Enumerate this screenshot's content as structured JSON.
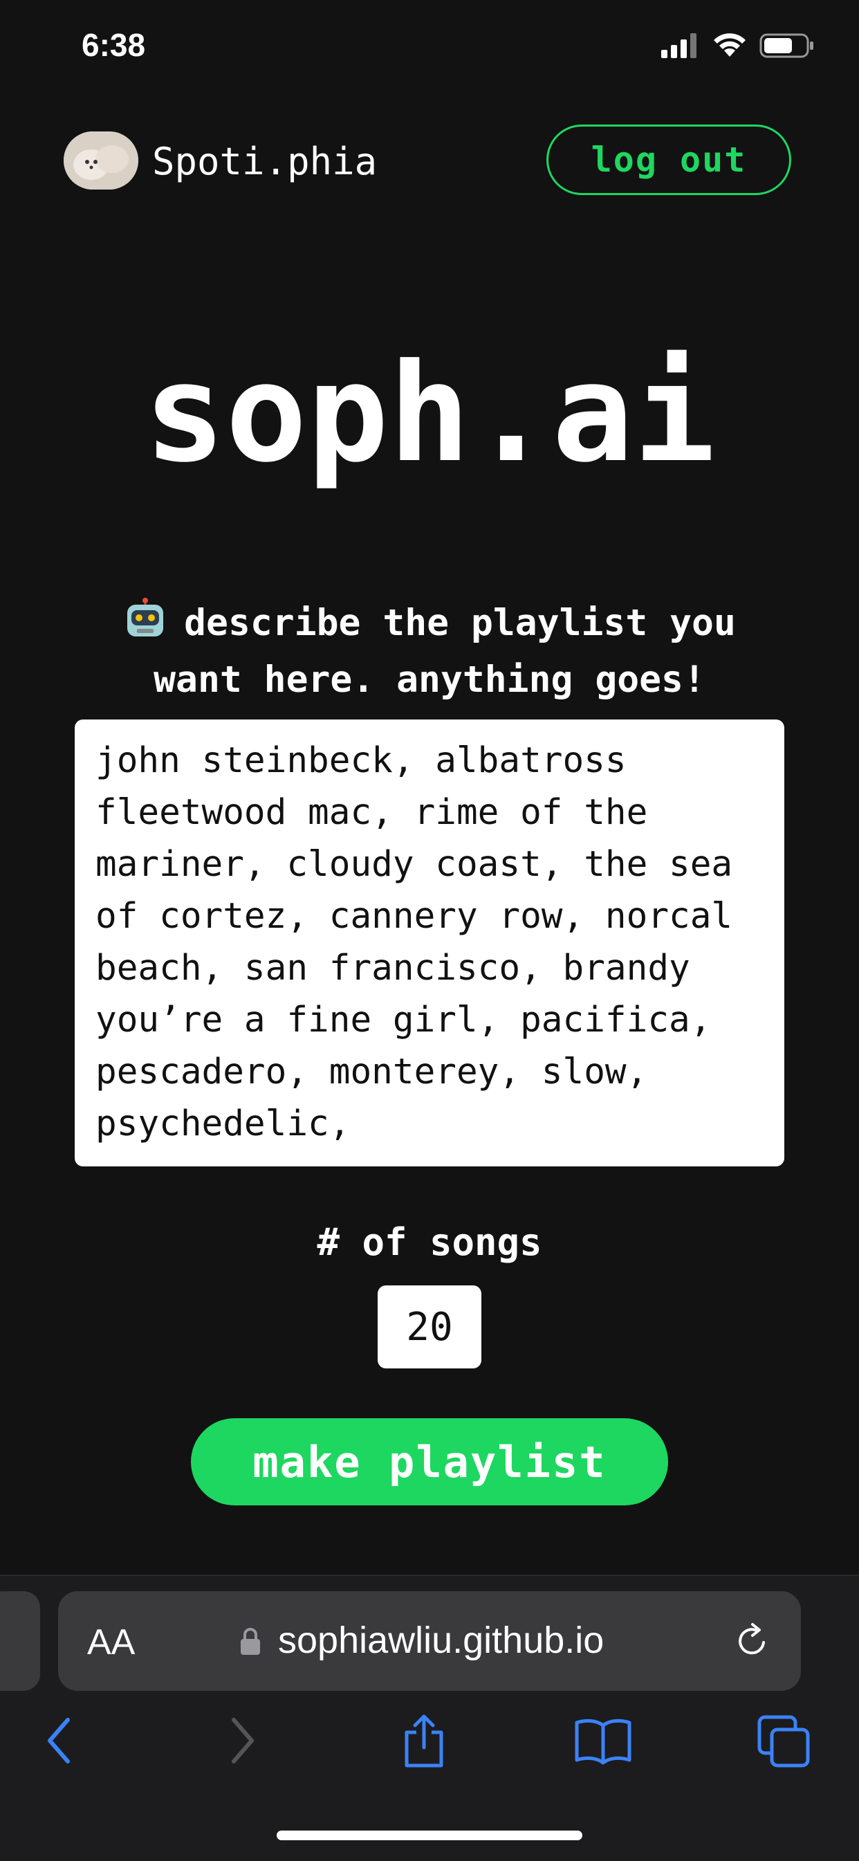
{
  "status_bar": {
    "time": "6:38"
  },
  "header": {
    "brand": "Spoti.phia",
    "logout_label": "log out"
  },
  "main": {
    "title": "soph.ai",
    "prompt": "describe the playlist you want here. anything goes!",
    "playlist_description": "john steinbeck, albatross fleetwood mac, rime of the mariner, cloudy coast, the sea of cortez, cannery row, norcal beach, san francisco, brandy you’re a fine girl, pacifica, pescadero, monterey, slow, psychedelic,",
    "songs_label": "# of songs",
    "songs_count": "20",
    "make_button_label": "make playlist"
  },
  "browser": {
    "text_size_label": "AA",
    "url": "sophiawliu.github.io"
  },
  "colors": {
    "accent": "#1ed760",
    "background": "#121212",
    "browser_chrome": "#1c1c1e",
    "safari_blue": "#3b82f6"
  },
  "icons": [
    "signal-icon",
    "wifi-icon",
    "battery-icon",
    "robot-icon",
    "lock-icon",
    "reload-icon",
    "back-icon",
    "forward-icon",
    "share-icon",
    "bookmarks-icon",
    "tabs-icon"
  ]
}
